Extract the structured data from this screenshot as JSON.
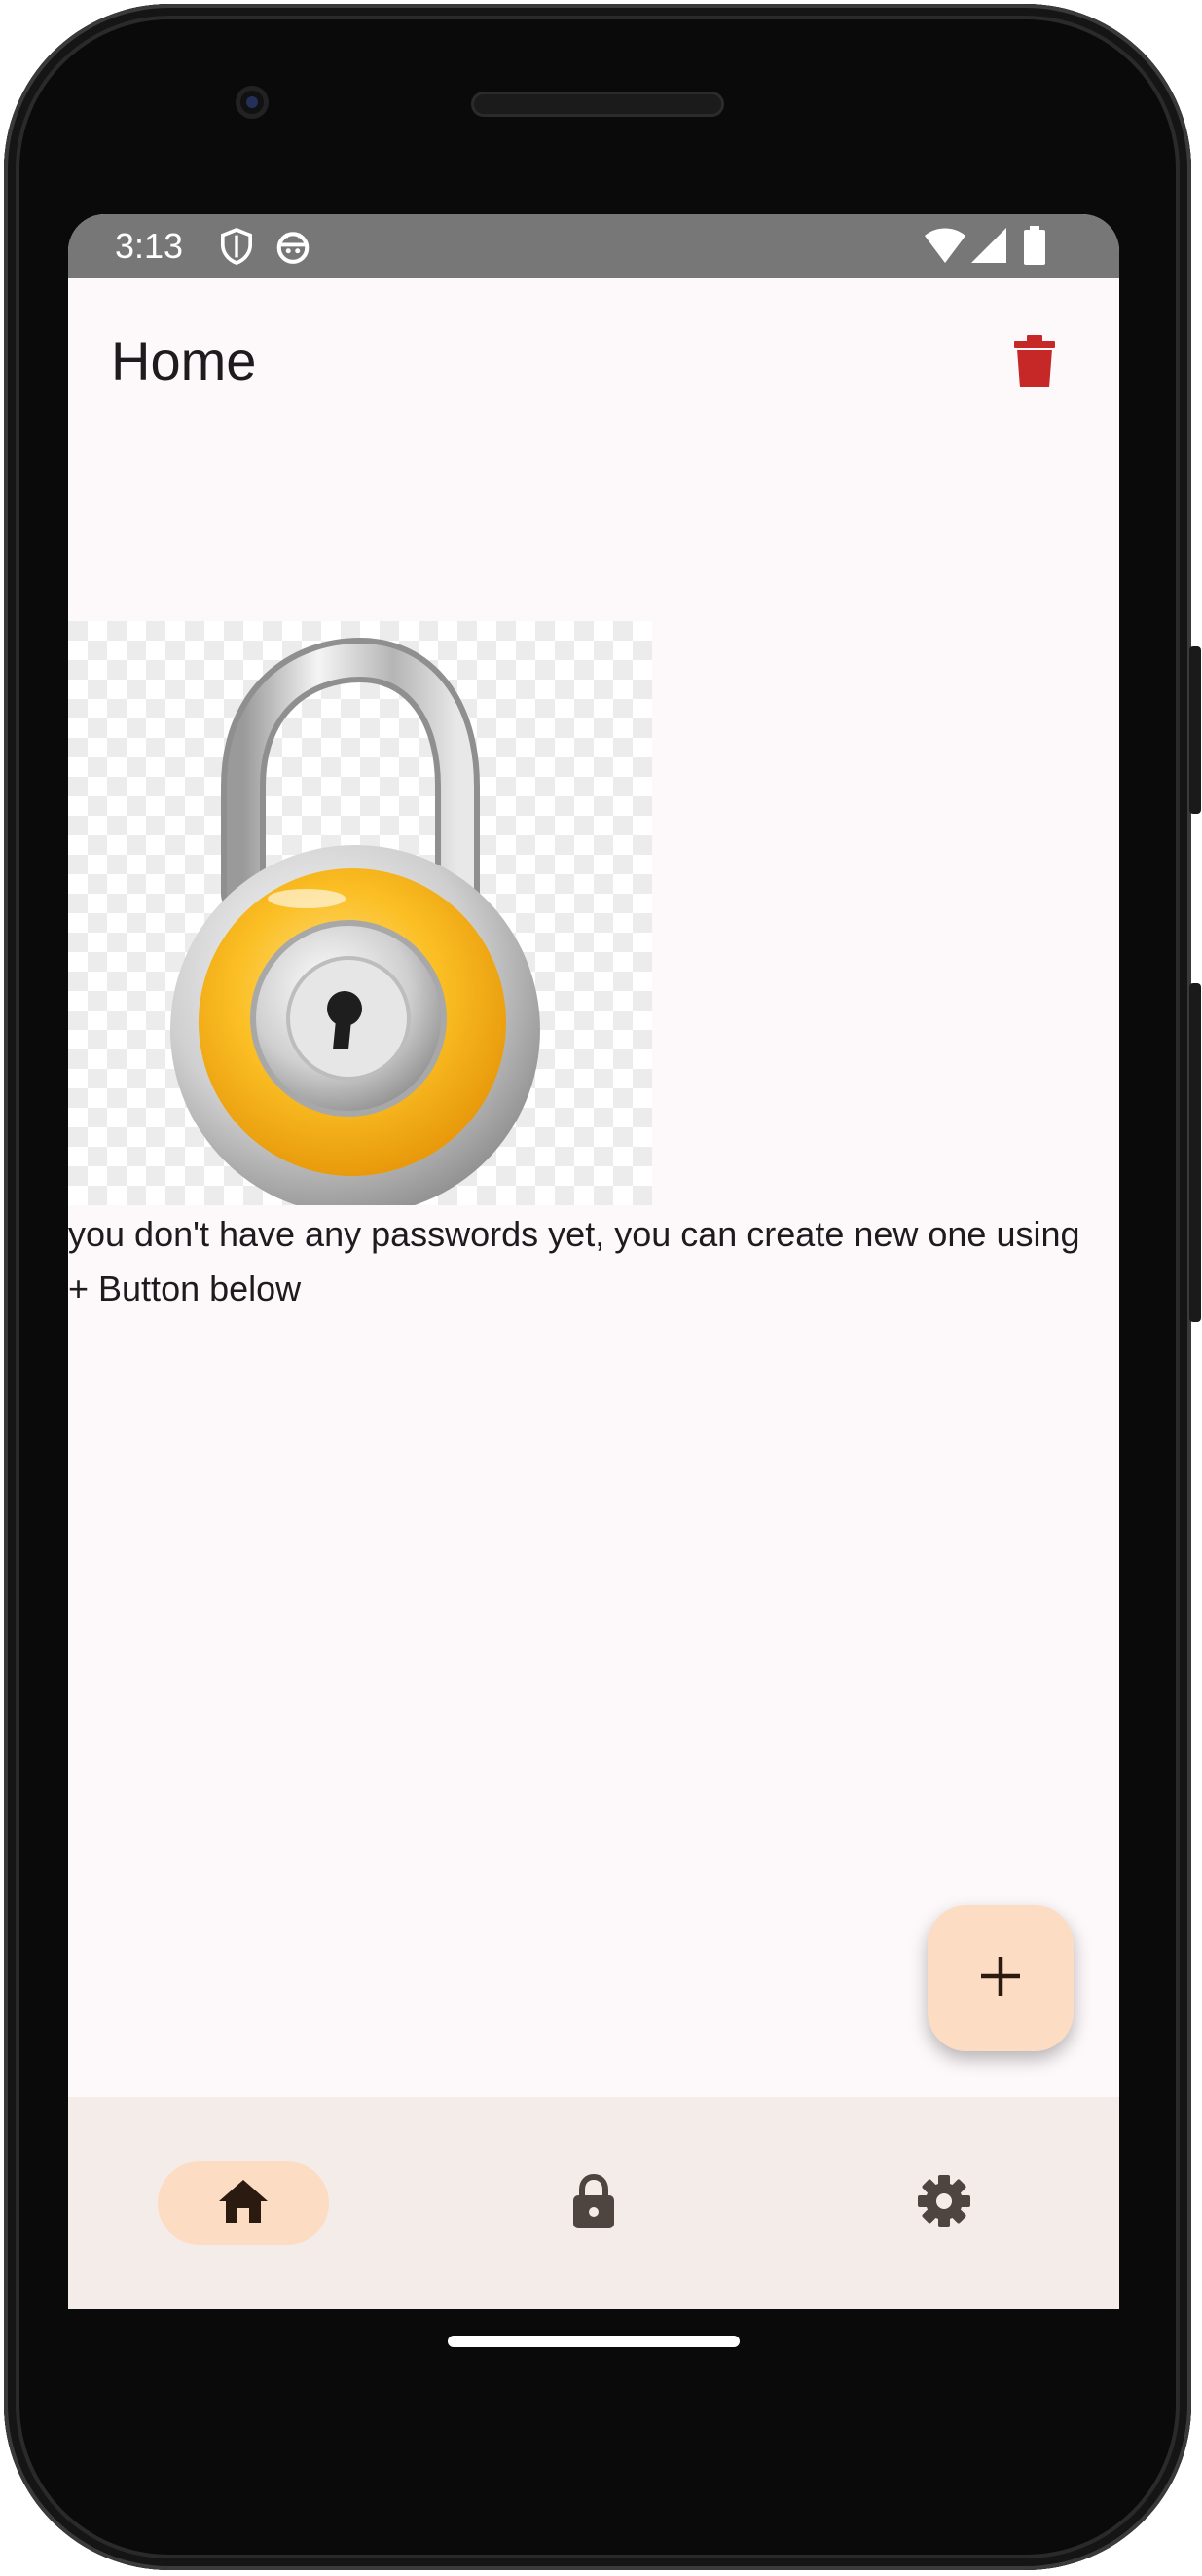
{
  "status_bar": {
    "time": "3:13",
    "left_icons": [
      "shield-icon",
      "android-face-icon"
    ],
    "right_icons": [
      "wifi-icon",
      "cell-signal-icon",
      "battery-icon"
    ]
  },
  "app_bar": {
    "title": "Home",
    "action_icon": "trash-icon",
    "action_color": "#c62828"
  },
  "content": {
    "image": "padlock-image",
    "empty_message": "you don't have any passwords yet, you can create new one using + Button below"
  },
  "fab": {
    "icon": "plus-icon",
    "label": "+",
    "background": "#fddcc4"
  },
  "bottom_nav": {
    "items": [
      {
        "name": "home",
        "icon": "home-icon",
        "active": true
      },
      {
        "name": "passwords",
        "icon": "lock-icon",
        "active": false
      },
      {
        "name": "settings",
        "icon": "gear-icon",
        "active": false
      }
    ],
    "active_indicator_color": "#fddcc4",
    "background": "#f4ece8"
  },
  "colors": {
    "screen_bg": "#fdf8fa",
    "text": "#1d1b1e",
    "icon": "#4e4540"
  }
}
